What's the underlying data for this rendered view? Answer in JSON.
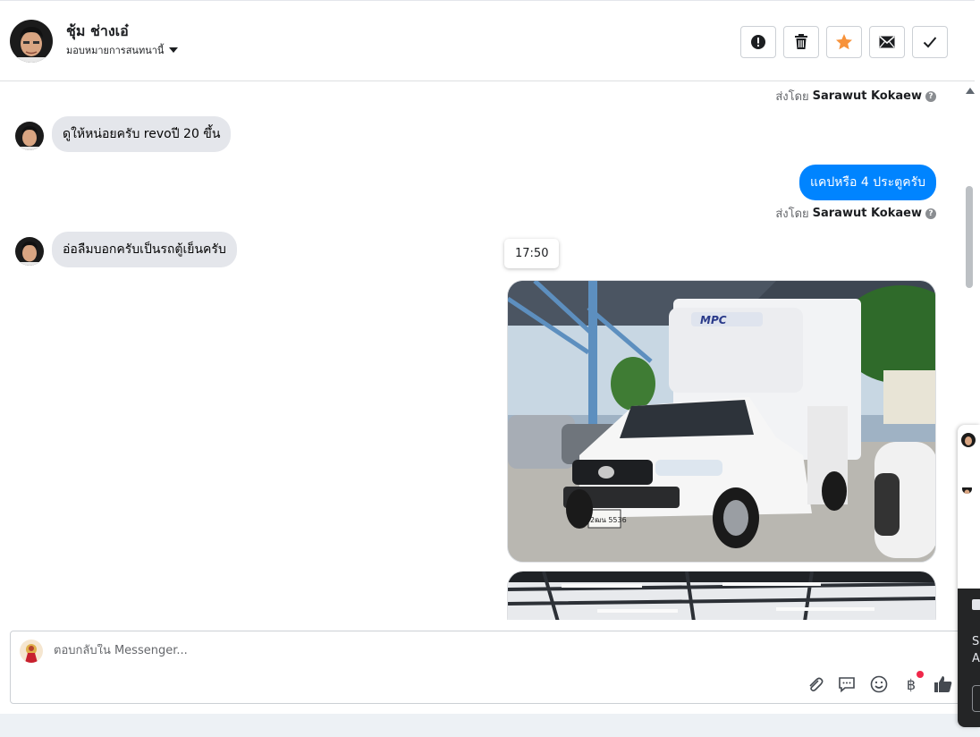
{
  "header": {
    "contact_name": "ชุ้ม ช่างเอ๋",
    "assign_label": "มอบหมายการสนทนานี้",
    "actions": [
      {
        "icon": "alert-icon",
        "label": "spam"
      },
      {
        "icon": "trash-icon",
        "label": "delete"
      },
      {
        "icon": "star-icon",
        "label": "follow-up"
      },
      {
        "icon": "envelope-icon",
        "label": "unread"
      },
      {
        "icon": "check-icon",
        "label": "done"
      }
    ]
  },
  "messages": {
    "sent_by_prefix": "ส่งโดย",
    "sent_by_name": "Sarawut Kokaew",
    "msg1": "ดูให้หน่อยครับ revoปี 20 ขึ้น",
    "msg2": "แคปหรือ 4 ประตูครับ",
    "msg3": "อ่อลืมบอกครับเป็นรถตู้เย็นครับ",
    "timestamp": "17:50"
  },
  "photo": {
    "plate": "2ฒน 5536",
    "brand": "MPC"
  },
  "composer": {
    "placeholder": "ตอบกลับใน Messenger...",
    "tools": [
      "paperclip-icon",
      "saved-reply-icon",
      "emoji-icon",
      "baht-icon",
      "like-icon"
    ]
  },
  "side_panel": {
    "line1": "S",
    "line2": "A"
  },
  "colors": {
    "outgoing_bubble": "#0084ff",
    "incoming_bubble": "#e4e6eb",
    "star_accent": "#f7923a"
  }
}
